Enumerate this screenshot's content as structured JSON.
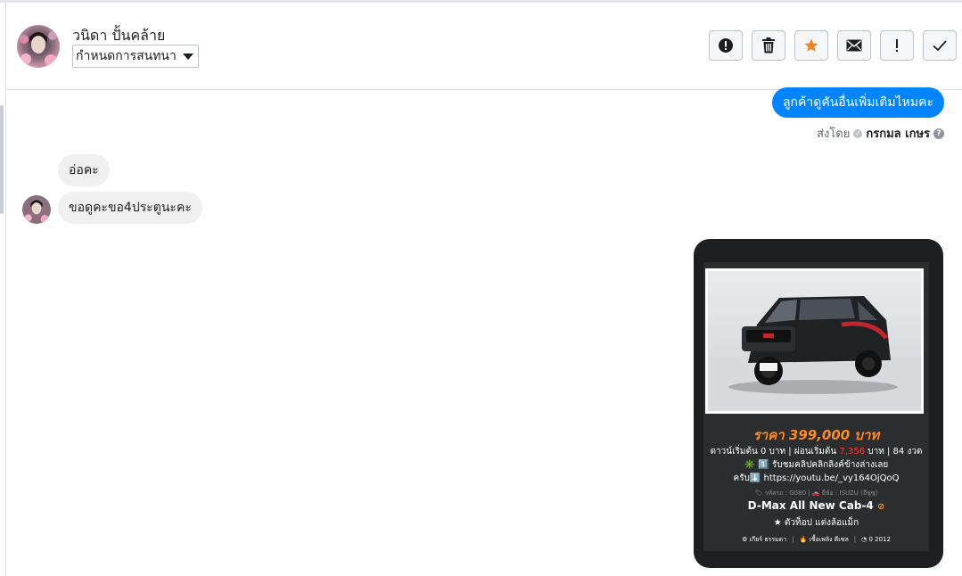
{
  "contact": {
    "name": "วนิดา ปั้นคล้าย",
    "label_select": "กำหนดการสนทนา"
  },
  "actions": [
    {
      "name": "mark-spam-button",
      "icon": "exclamation-circle-icon"
    },
    {
      "name": "delete-button",
      "icon": "trash-icon"
    },
    {
      "name": "star-button",
      "icon": "star-icon"
    },
    {
      "name": "mail-button",
      "icon": "envelope-icon"
    },
    {
      "name": "important-button",
      "icon": "exclamation-icon"
    },
    {
      "name": "done-button",
      "icon": "check-icon"
    }
  ],
  "messages": {
    "outgoing_1": "ลูกค้าดูคันอื่นเพิ่มเติมไหมคะ",
    "sent_by_prefix": "ส่งโดย",
    "sent_by_agent": "กรกมล เกษร",
    "incoming_1": "อ่อคะ",
    "incoming_2": "ขอดูคะขอ4ประตูนะคะ"
  },
  "card": {
    "price": "ราคา 399,000 บาท",
    "down_prefix": "ดาวน์เริ่มต้น 0 บาท | ผ่อนเริ่มต้น ",
    "installment": "7,356",
    "down_suffix": " บาท | 84 งวด",
    "clip_line": "✳️ 1️⃣ รับชมคลิปคลิกลิงค์ข้างล่างเลย",
    "link_line": "ครับ⬇️ https://youtu.be/_vy164OjQoQ",
    "meta_line": "🏷 รหัสรถ : G080 | 🚗 ยี่ห้อ : ISUZU (อีซูซุ)",
    "model": "D-Max All New Cab-4",
    "tagline": "★ ตัวท็อป แต่งล้อแม็ก",
    "gear": "⚙ เกียร์ ธรรมดา",
    "fuel": "🔥 เชื้อเพลิง ดีเซล",
    "year": "◔ 0 2012",
    "accent_color": "#ff8a1e"
  }
}
